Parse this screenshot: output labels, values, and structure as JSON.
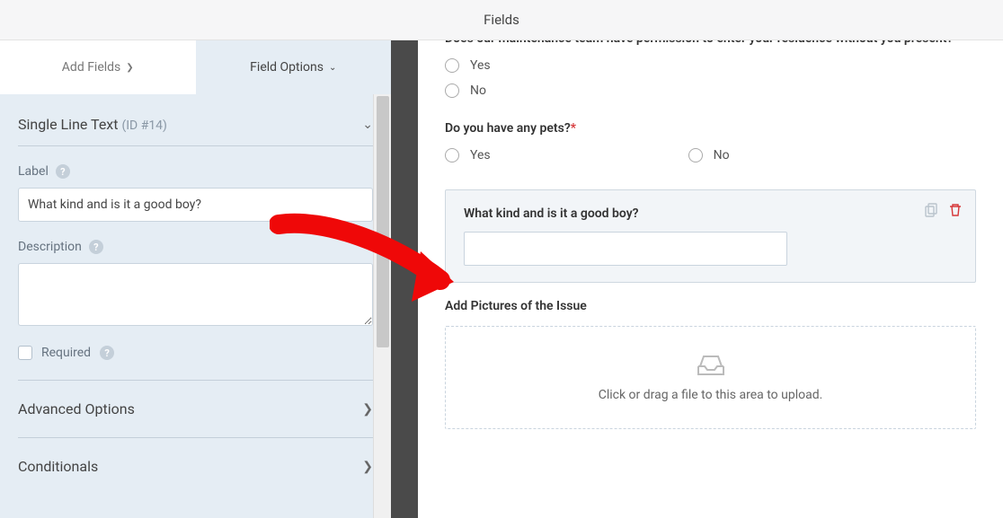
{
  "header": {
    "title": "Fields"
  },
  "tabs": {
    "add_fields": "Add Fields",
    "field_options": "Field Options"
  },
  "field_header": {
    "type": "Single Line Text",
    "id": "(ID #14)"
  },
  "options": {
    "label_text": "Label",
    "label_value": "What kind and is it a good boy?",
    "description_text": "Description",
    "required_text": "Required"
  },
  "sections": {
    "advanced": "Advanced Options",
    "conditionals": "Conditionals"
  },
  "preview": {
    "q1": "Does our maintenance team have permission to enter your residence without you present?",
    "q2": "Do you have any pets?",
    "yes": "Yes",
    "no": "No",
    "selected_label": "What kind and is it a good boy?",
    "upload_title": "Add Pictures of the Issue",
    "upload_hint": "Click or drag a file to this area to upload."
  }
}
